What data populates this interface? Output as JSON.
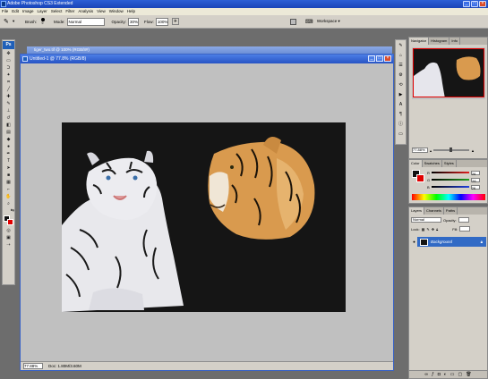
{
  "app": {
    "title": "Adobe Photoshop CS3 Extended",
    "window_controls": [
      "_",
      "□",
      "×"
    ]
  },
  "menu": [
    "File",
    "Edit",
    "Image",
    "Layer",
    "Select",
    "Filter",
    "Analysis",
    "View",
    "Window",
    "Help"
  ],
  "options_bar": {
    "brush_label": "Brush:",
    "brush_size": "9",
    "mode_label": "Mode:",
    "mode_value": "Normal",
    "opacity_label": "Opacity:",
    "opacity_value": "30%",
    "flow_label": "Flow:",
    "flow_value": "100%",
    "workspace_label": "Workspace ▾"
  },
  "toolbox": {
    "logo": "Ps"
  },
  "document": {
    "title": "Untitled-1 @ 77.8% (RGB/8)",
    "behind_title": "tiger_two.tif @ 100% (RGB/8#)",
    "zoom": "77.88%",
    "doc_size": "Doc: 1.80M/3.60M"
  },
  "navigator": {
    "tabs": [
      "Navigator",
      "Histogram",
      "Info"
    ],
    "zoom": "77.88%"
  },
  "color_panel": {
    "tabs": [
      "Color",
      "Swatches",
      "Styles"
    ],
    "channels": [
      {
        "label": "R",
        "value": "26",
        "color": "#e02020"
      },
      {
        "label": "G",
        "value": "26",
        "color": "#20a020"
      },
      {
        "label": "B",
        "value": "26",
        "color": "#2040e0"
      }
    ]
  },
  "layers_panel": {
    "tabs": [
      "Layers",
      "Channels",
      "Paths"
    ],
    "blend_mode": "Normal",
    "opacity_label": "Opacity:",
    "lock_label": "Lock:",
    "fill_label": "Fill:",
    "layer_name": "Background"
  },
  "colors": {
    "accent": "#316ac5",
    "titlebar": "#2754c4",
    "foreground": "#111111",
    "background": "#e10000"
  }
}
